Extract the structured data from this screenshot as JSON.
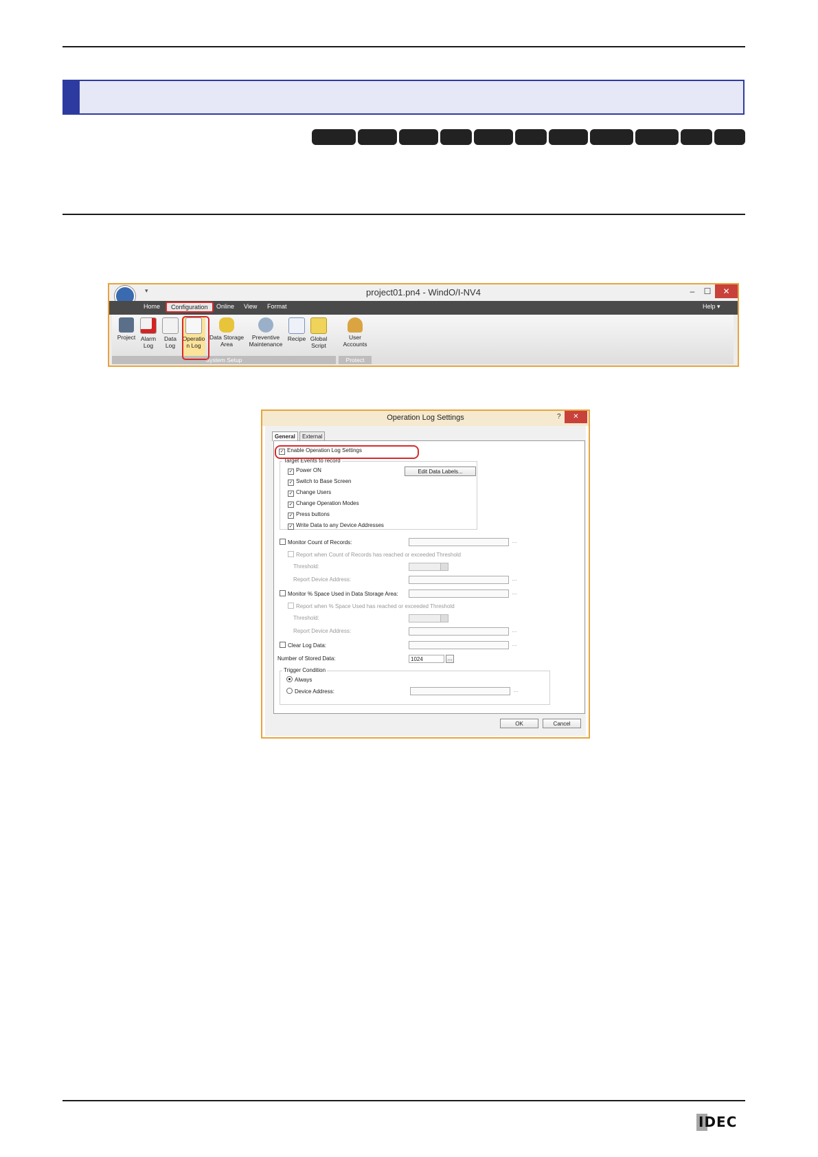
{
  "ribbon": {
    "window_title": "project01.pn4 - WindO/I-NV4",
    "quick_access": "▾",
    "minimize": "–",
    "maximize": "☐",
    "close": "✕",
    "tabs": [
      "Home",
      "Configuration",
      "Online",
      "View",
      "Format"
    ],
    "help": "Help ▾",
    "buttons": [
      {
        "label1": "Project",
        "label2": ""
      },
      {
        "label1": "Alarm",
        "label2": "Log"
      },
      {
        "label1": "Data",
        "label2": "Log"
      },
      {
        "label1": "Operatio",
        "label2": "n Log"
      },
      {
        "label1": "Data Storage",
        "label2": "Area"
      },
      {
        "label1": "Preventive",
        "label2": "Maintenance"
      },
      {
        "label1": "Recipe",
        "label2": ""
      },
      {
        "label1": "Global",
        "label2": "Script"
      },
      {
        "label1": "User",
        "label2": "Accounts"
      }
    ],
    "group_system": "System Setup",
    "group_protect": "Protect"
  },
  "dialog": {
    "title": "Operation Log Settings",
    "help_btn": "?",
    "close_btn": "✕",
    "tab_general": "General",
    "tab_external": "External Memory Device",
    "enable": "Enable Operation Log Settings",
    "target_events": "Target Events to record",
    "events": [
      "Power ON",
      "Switch to Base Screen",
      "Change Users",
      "Change Operation Modes",
      "Press buttons",
      "Write Data to any Device Addresses"
    ],
    "edit_labels": "Edit Data Labels...",
    "monitor_count": "Monitor Count of Records:",
    "report_count": "Report when Count of Records has reached or exceeded Threshold",
    "threshold1": "Threshold:",
    "report_addr1": "Report Device Address:",
    "monitor_space": "Monitor % Space Used in Data Storage Area:",
    "report_space": "Report when % Space Used has reached or exceeded Threshold",
    "threshold2": "Threshold:",
    "report_addr2": "Report Device Address:",
    "clear_log": "Clear Log Data:",
    "stored_label": "Number of Stored Data:",
    "stored_value": "1024",
    "trigger": "Trigger Condition",
    "always": "Always",
    "device_address": "Device Address:",
    "ok": "OK",
    "cancel": "Cancel",
    "ellipsis": "..."
  },
  "footer": {
    "logo": "IDEC"
  }
}
